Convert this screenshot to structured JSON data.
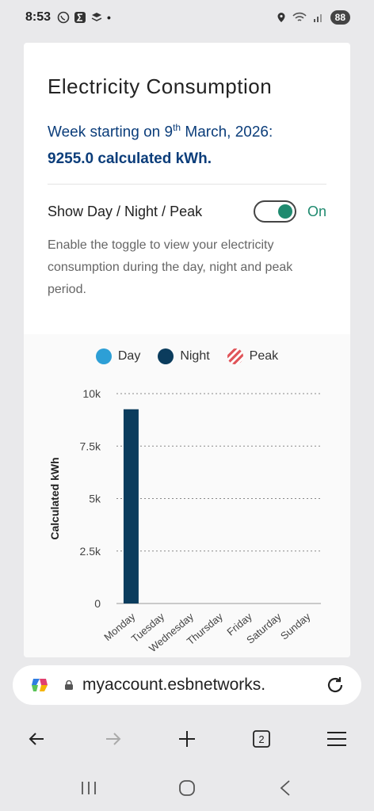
{
  "status_bar": {
    "time": "8:53",
    "battery": "88"
  },
  "page": {
    "title": "Electricity Consumption",
    "week_prefix": "Week starting on 9",
    "week_sup": "th",
    "week_suffix": " March, 2026:",
    "total": "9255.0 calculated kWh.",
    "toggle_label": "Show Day / Night / Peak",
    "toggle_state": "On",
    "toggle_help": "Enable the toggle to view your electricity consumption during the day, night and peak period."
  },
  "legend": [
    {
      "label": "Day",
      "color": "#2d9fd6"
    },
    {
      "label": "Night",
      "color": "#0b3c5d"
    },
    {
      "label": "Peak",
      "color": "#e0565b"
    }
  ],
  "chart_data": {
    "type": "bar",
    "categories": [
      "Monday",
      "Tuesday",
      "Wednesday",
      "Thursday",
      "Friday",
      "Saturday",
      "Sunday"
    ],
    "series": [
      {
        "name": "Day",
        "values": [
          0,
          0,
          0,
          0,
          0,
          0,
          0
        ]
      },
      {
        "name": "Night",
        "values": [
          9255,
          0,
          0,
          0,
          0,
          0,
          0
        ]
      },
      {
        "name": "Peak",
        "values": [
          0,
          0,
          0,
          0,
          0,
          0,
          0
        ]
      }
    ],
    "ylabel": "Calculated kWh",
    "ylim": [
      0,
      10000
    ],
    "yticks": [
      "0",
      "2.5k",
      "5k",
      "7.5k",
      "10k"
    ],
    "yticks_values": [
      0,
      2500,
      5000,
      7500,
      10000
    ],
    "grid": true
  },
  "browser": {
    "url": "myaccount.esbnetworks.",
    "tab_count": "2"
  }
}
